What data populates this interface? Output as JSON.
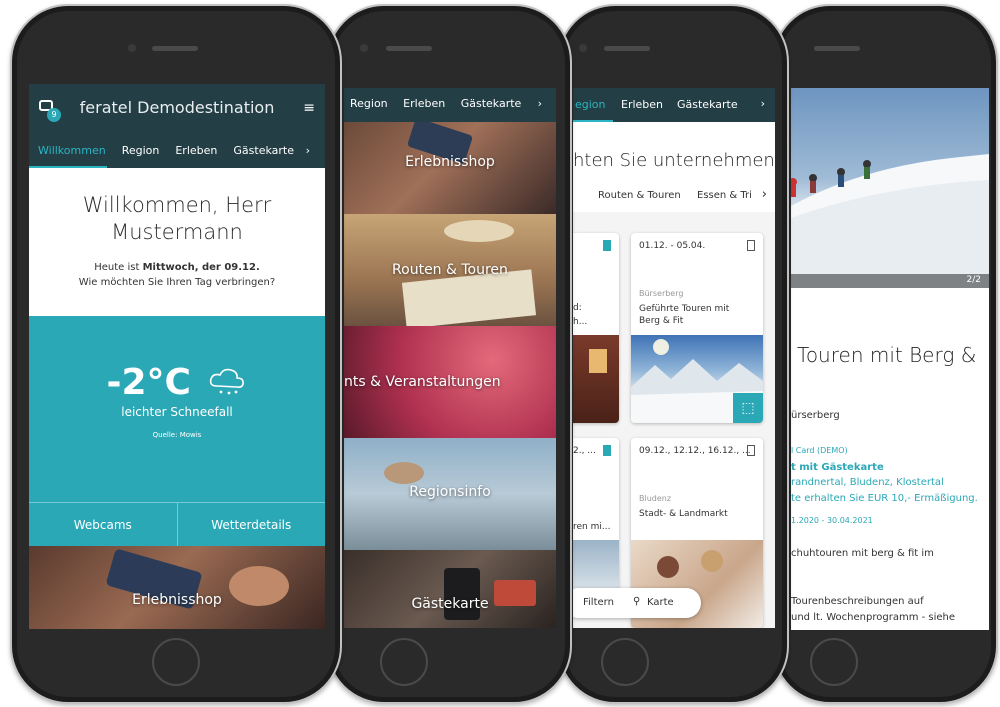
{
  "colors": {
    "header": "#233e44",
    "accent": "#2bb5c3",
    "weather_bg": "#2aa8b6"
  },
  "p1": {
    "app_title": "feratel Demodestination",
    "badge": "9",
    "tabs": [
      "Willkommen",
      "Region",
      "Erleben",
      "Gästekarte"
    ],
    "greeting_line1": "Willkommen, Herr",
    "greeting_line2": "Mustermann",
    "date_prefix": "Heute ist ",
    "date_bold": "Mittwoch, der 09.12.",
    "question": "Wie möchten Sie Ihren Tag verbringen?",
    "temperature": "-2°C",
    "condition": "leichter Schneefall",
    "source": "Quelle: Mowis",
    "btn_webcams": "Webcams",
    "btn_wetter": "Wetterdetails",
    "photo_label": "Erlebnisshop"
  },
  "p2": {
    "tabs": [
      "Region",
      "Erleben",
      "Gästekarte"
    ],
    "tiles": [
      "Erlebnisshop",
      "Routen & Touren",
      "nts & Veranstaltungen",
      "Regionsinfo",
      "Gästekarte"
    ]
  },
  "p3": {
    "tabs": [
      "egion",
      "Erleben",
      "Gästekarte"
    ],
    "heading": "hten Sie unternehmen?",
    "filter_tabs": [
      "Routen & Touren",
      "Essen & Tri"
    ],
    "card1": {
      "date": "01.12. - 05.04.",
      "place": "Bürserberg",
      "name_l1": "Geführte Touren mit",
      "name_l2": "Berg & Fit"
    },
    "card_left_a": {
      "t1": "d:",
      "t2": "h..."
    },
    "card_left_b": {
      "date": "2., ...",
      "name": "ren mi..."
    },
    "card2": {
      "date": "09.12., 12.12., 16.12., ...",
      "place": "Bludenz",
      "name": "Stadt- & Landmarkt"
    },
    "btn_filter": "Filtern",
    "btn_karte": "Karte"
  },
  "p4": {
    "counter": "2/2",
    "title_l1": "Touren mit Berg &",
    "place": "ürserberg",
    "card_label": "l Card (DEMO)",
    "bold_line": "t mit Gästekarte",
    "regions": "randnertal, Bludenz, Klostertal",
    "discount": "te erhalten Sie EUR 10,- Ermäßigung.",
    "validity": "1.2020 - 30.04.2021",
    "desc_l1": "chuhtouren mit berg & fit im",
    "desc_l2": "Tourenbeschreibungen auf",
    "desc_l3": "und lt. Wochenprogramm - siehe"
  }
}
